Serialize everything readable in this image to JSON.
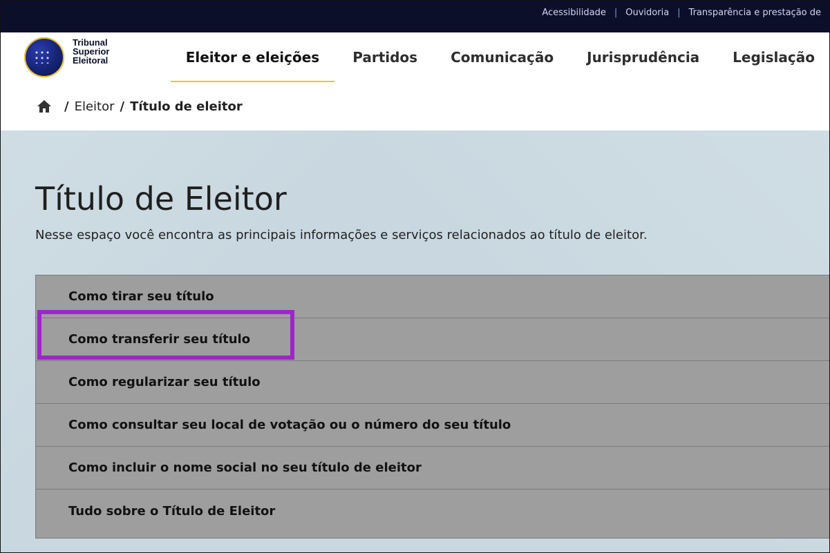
{
  "topbar": {
    "links": [
      "Acessibilidade",
      "Ouvidoria",
      "Transparência e prestação de"
    ]
  },
  "header": {
    "logo_lines": [
      "Tribunal",
      "Superior",
      "Eleitoral"
    ],
    "nav": [
      "Eleitor e eleições",
      "Partidos",
      "Comunicação",
      "Jurisprudência",
      "Legislação"
    ],
    "active_nav": "Eleitor e eleições"
  },
  "breadcrumb": {
    "home_icon": "home-icon",
    "items": [
      "Eleitor",
      "Título de eleitor"
    ]
  },
  "main": {
    "title": "Título de Eleitor",
    "description": "Nesse espaço você encontra as principais informações e serviços relacionados ao título de eleitor.",
    "accordion": [
      "Como tirar seu título",
      "Como transferir seu título",
      "Como regularizar seu título",
      "Como consultar seu local de votação ou o número do seu título",
      "Como incluir o nome social no seu título de eleitor",
      "Tudo sobre o Título de Eleitor"
    ]
  },
  "colors": {
    "topbar": "#0b0f2a",
    "accent": "#f0c419",
    "hero_bg": "#c9d8e0",
    "highlight": "#9d26c9"
  }
}
